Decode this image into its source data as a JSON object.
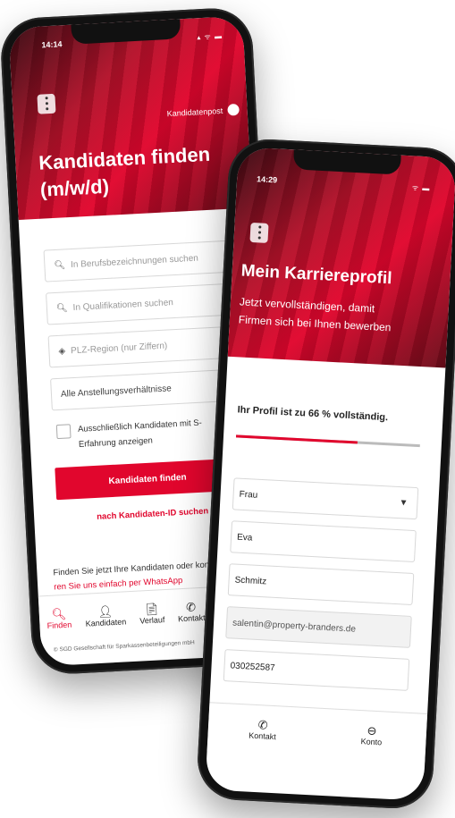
{
  "phone1": {
    "time": "14:14",
    "status_icons": "▴ ᯤ ▬",
    "account_label": "Kandidatenpost",
    "title_line1": "Kandidaten finden",
    "title_line2": "(m/w/d)",
    "search_job_placeholder": "In Berufsbezeichnungen suchen",
    "search_qual_placeholder": "In Qualifikationen suchen",
    "postal_placeholder": "PLZ-Region (nur Ziffern)",
    "employment_select": "Alle Anstellungsverhältnisse",
    "checkbox_label": "Ausschließlich Kandidaten mit S-Erfahrung anzeigen",
    "find_button": "Kandidaten finden",
    "id_link": "nach Kandidaten-ID suchen",
    "info_text": "Finden Sie jetzt Ihre Kandidaten oder kon",
    "info_link": "ren Sie uns einfach per WhatsApp",
    "footer_text": "© SGD Gesellschaft für Sparkassenbeteiligungen mbH",
    "tabs": [
      {
        "icon": "search-icon",
        "glyph": "🔍︎",
        "label": "Finden",
        "color": "#e1062d"
      },
      {
        "icon": "person-icon",
        "glyph": "👤︎",
        "label": "Kandidaten",
        "color": "#222222"
      },
      {
        "icon": "document-icon",
        "glyph": "📄︎",
        "label": "Verlauf",
        "color": "#222222"
      },
      {
        "icon": "phone-icon",
        "glyph": "✆",
        "label": "Kontakt",
        "color": "#222222"
      }
    ]
  },
  "phone2": {
    "time": "14:29",
    "status_icons": "ᯤ ▬",
    "title": "Mein Karriereprofil",
    "subtitle_line1": "Jetzt vervollständigen, damit",
    "subtitle_line2": "Firmen sich bei Ihnen bewerben",
    "progress_text": "Ihr Profil ist zu 66 % vollständig.",
    "progress_fraction": 0.66,
    "salutation": "Frau",
    "first_name": "Eva",
    "last_name": "Schmitz",
    "email": "salentin@property-branders.de",
    "phone": "030252587",
    "tabs": [
      {
        "icon": "phone-icon",
        "glyph": "✆",
        "label": "Kontakt"
      },
      {
        "icon": "account-icon",
        "glyph": "⊖",
        "label": "Konto"
      }
    ]
  },
  "colors": {
    "accent": "#e1062d",
    "progress_track": "#bbbbbb"
  }
}
